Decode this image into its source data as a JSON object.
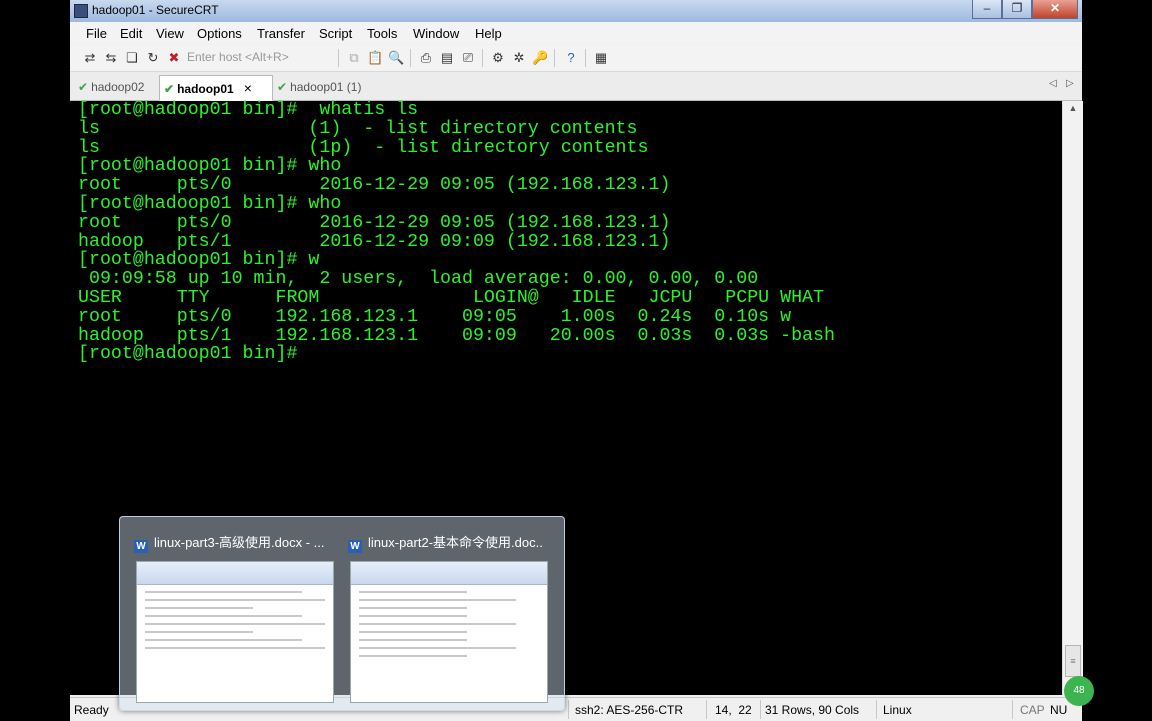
{
  "window": {
    "title": "hadoop01 - SecureCRT"
  },
  "menu": [
    "File",
    "Edit",
    "View",
    "Options",
    "Transfer",
    "Script",
    "Tools",
    "Window",
    "Help"
  ],
  "toolbar": {
    "host_placeholder": "Enter host <Alt+R>"
  },
  "tabs": [
    {
      "label": "hadoop02",
      "active": false
    },
    {
      "label": "hadoop01",
      "active": true
    },
    {
      "label": "hadoop01 (1)",
      "active": false
    }
  ],
  "terminal": {
    "lines": [
      "[root@hadoop01 bin]#  whatis ls",
      "ls                   (1)  - list directory contents",
      "ls                   (1p)  - list directory contents",
      "[root@hadoop01 bin]# who",
      "root     pts/0        2016-12-29 09:05 (192.168.123.1)",
      "[root@hadoop01 bin]# who",
      "root     pts/0        2016-12-29 09:05 (192.168.123.1)",
      "hadoop   pts/1        2016-12-29 09:09 (192.168.123.1)",
      "[root@hadoop01 bin]# w",
      " 09:09:58 up 10 min,  2 users,  load average: 0.00, 0.00, 0.00",
      "USER     TTY      FROM              LOGIN@   IDLE   JCPU   PCPU WHAT",
      "root     pts/0    192.168.123.1    09:05    1.00s  0.24s  0.10s w",
      "hadoop   pts/1    192.168.123.1    09:09   20.00s  0.03s  0.03s -bash",
      "[root@hadoop01 bin]#"
    ],
    "text_color": "#2cf22c",
    "background": "#000000"
  },
  "status": {
    "ready": "Ready",
    "cipher": "ssh2: AES-256-CTR",
    "cursor": "14,  22",
    "size": "31 Rows, 90 Cols",
    "os": "Linux",
    "cap": "CAP",
    "num": "NU"
  },
  "taskbar_preview": {
    "items": [
      {
        "title": "linux-part3-高级使用.docx - ..."
      },
      {
        "title": "linux-part2-基本命令使用.doc..."
      }
    ]
  },
  "notification_badge": "48"
}
